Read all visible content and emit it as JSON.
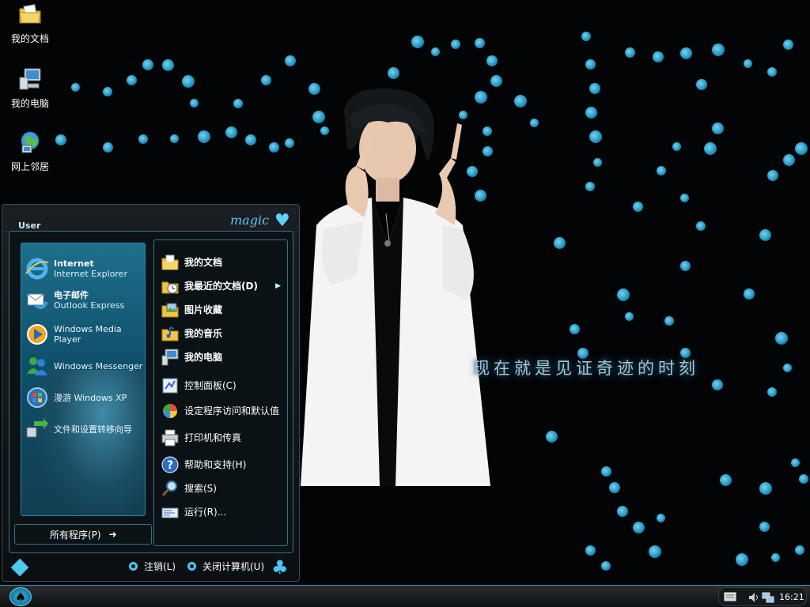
{
  "desktop": {
    "icons": [
      {
        "label": "我的文档",
        "icon": "documents-folder-icon"
      },
      {
        "label": "我的电脑",
        "icon": "computer-icon"
      },
      {
        "label": "网上邻居",
        "icon": "network-places-icon"
      }
    ],
    "wallpaper_text": "现在就是见证奇迹的时刻"
  },
  "start_menu": {
    "user_name": "User",
    "brand": "magic",
    "pinned": [
      {
        "title": "Internet",
        "subtitle": "Internet Explorer",
        "icon": "internet-explorer-icon"
      },
      {
        "title": "电子邮件",
        "subtitle": "Outlook Express",
        "icon": "outlook-express-icon"
      }
    ],
    "recent": [
      {
        "label": "Windows Media Player",
        "icon": "media-player-icon"
      },
      {
        "label": "Windows Messenger",
        "icon": "messenger-icon"
      },
      {
        "label": "漫游 Windows XP",
        "icon": "tour-xp-icon"
      },
      {
        "label": "文件和设置转移向导",
        "icon": "transfer-wizard-icon"
      }
    ],
    "all_programs": "所有程序(P)",
    "right_items": [
      {
        "label": "我的文档",
        "icon": "my-documents-icon",
        "bold": true
      },
      {
        "label": "我最近的文档(D)",
        "icon": "recent-documents-icon",
        "bold": true,
        "submenu": true
      },
      {
        "label": "图片收藏",
        "icon": "my-pictures-icon",
        "bold": true
      },
      {
        "label": "我的音乐",
        "icon": "my-music-icon",
        "bold": true
      },
      {
        "label": "我的电脑",
        "icon": "my-computer-icon",
        "bold": true
      },
      {
        "label": "控制面板(C)",
        "icon": "control-panel-icon"
      },
      {
        "label": "设定程序访问和默认值",
        "icon": "program-defaults-icon"
      },
      {
        "label": "打印机和传真",
        "icon": "printers-fax-icon"
      },
      {
        "label": "帮助和支持(H)",
        "icon": "help-support-icon"
      },
      {
        "label": "搜索(S)",
        "icon": "search-icon"
      },
      {
        "label": "运行(R)...",
        "icon": "run-icon"
      }
    ],
    "logoff": "注销(L)",
    "shutdown": "关闭计算机(U)"
  },
  "taskbar": {
    "clock": "16:21"
  },
  "colors": {
    "accent": "#4dc8f2",
    "panel_border": "#3c6f86",
    "background": "#020406"
  }
}
